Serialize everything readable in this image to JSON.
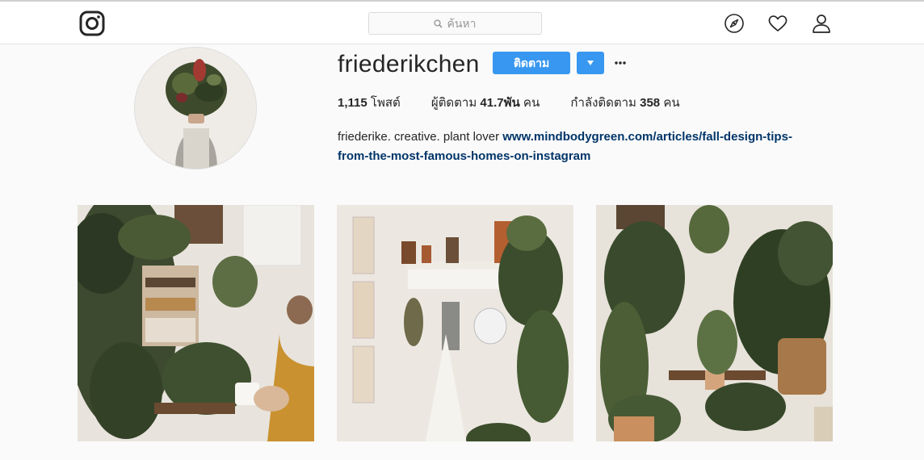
{
  "app": {
    "name": "Instagram"
  },
  "header": {
    "logo_icon": "instagram-camera-icon",
    "search_placeholder": "ค้นหา",
    "nav_icons": [
      "compass-icon",
      "heart-icon",
      "user-icon"
    ]
  },
  "profile": {
    "username": "friederikchen",
    "follow_label": "ติดตาม",
    "stats": {
      "posts_count": "1,115",
      "posts_label": "โพสต์",
      "followers_label": "ผู้ติดตาม",
      "followers_count": "41.7พัน",
      "followers_unit": "คน",
      "following_label": "กำลังติดตาม",
      "following_count": "358",
      "following_unit": "คน"
    },
    "bio_text": "friederike. creative. plant lover",
    "bio_link": "www.mindbodygreen.com/articles/fall-design-tips-from-the-most-famous-homes-on-instagram"
  },
  "colors": {
    "accent": "#3897f0",
    "link": "#003569",
    "background": "#fafafa"
  }
}
